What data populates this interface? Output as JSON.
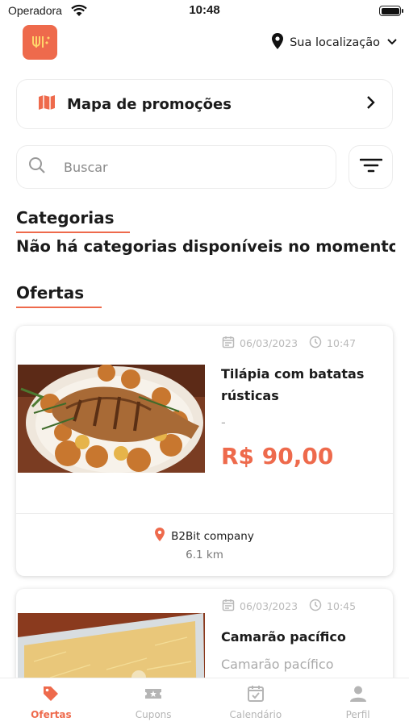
{
  "status_bar": {
    "carrier": "Operadora",
    "time": "10:48"
  },
  "header": {
    "location_label": "Sua localização"
  },
  "promo": {
    "title": "Mapa de promoções"
  },
  "search": {
    "placeholder": "Buscar"
  },
  "categories": {
    "title": "Categorias",
    "empty_message": "Não há categorias disponíveis no momento"
  },
  "offers": {
    "title": "Ofertas",
    "items": [
      {
        "date": "06/03/2023",
        "time": "10:47",
        "name": "Tilápia com batatas rústicas",
        "subtitle": "-",
        "price": "R$ 90,00",
        "company": "B2Bit company",
        "distance": "6.1 km"
      },
      {
        "date": "06/03/2023",
        "time": "10:45",
        "name": "Camarão pacífico",
        "subtitle": "Camarão pacífico"
      }
    ]
  },
  "tabs": [
    {
      "label": "Ofertas",
      "icon": "tag-icon",
      "active": true
    },
    {
      "label": "Cupons",
      "icon": "ticket-icon",
      "active": false
    },
    {
      "label": "Calendário",
      "icon": "calendar-check-icon",
      "active": false
    },
    {
      "label": "Perfil",
      "icon": "user-icon",
      "active": false
    }
  ],
  "colors": {
    "accent": "#ee6a4c",
    "text": "#1b1b1b",
    "muted": "#aaaaaa",
    "border": "#ececec"
  }
}
